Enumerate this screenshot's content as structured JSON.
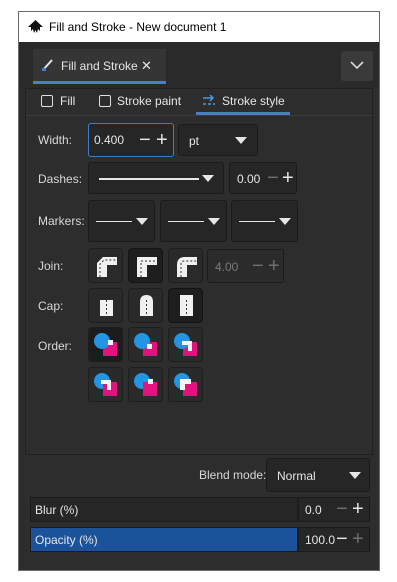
{
  "window": {
    "title": "Fill and Stroke - New document 1"
  },
  "dialog_tab": {
    "label": "Fill and Stroke",
    "close_glyph": "✕"
  },
  "subtabs": [
    {
      "label": "Fill",
      "icon": "checkbox-square-icon"
    },
    {
      "label": "Stroke paint",
      "icon": "checkbox-square-icon"
    },
    {
      "label": "Stroke style",
      "icon": "stroke-style-icon",
      "active": true
    }
  ],
  "width": {
    "label": "Width:",
    "value": "0.400",
    "unit": "pt"
  },
  "dashes": {
    "label": "Dashes:",
    "offset": "0.00"
  },
  "markers": {
    "label": "Markers:"
  },
  "join": {
    "label": "Join:",
    "miter_limit": "4.00"
  },
  "cap": {
    "label": "Cap:"
  },
  "order": {
    "label": "Order:"
  },
  "blend": {
    "label": "Blend mode:",
    "value": "Normal"
  },
  "blur": {
    "label": "Blur (%)",
    "value": "0.0",
    "level_percent": 0
  },
  "opacity": {
    "label": "Opacity (%)",
    "value": "100.0",
    "level_percent": 100
  },
  "colors": {
    "accent": "#4a7fc0",
    "fill_cyan": "#2296e4",
    "stroke_magenta": "#e4127e",
    "opacity_fill": "#1a5399"
  }
}
